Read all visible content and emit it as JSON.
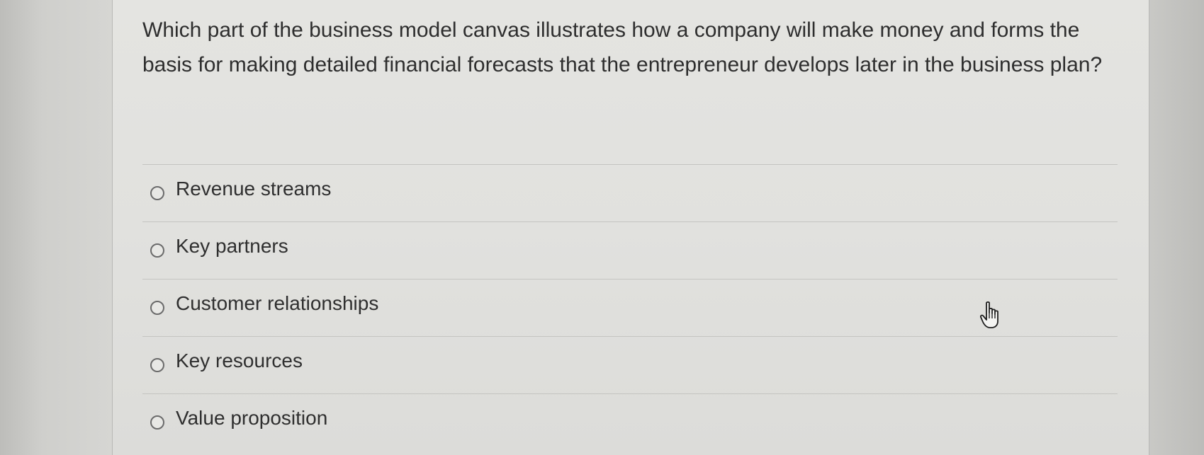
{
  "question": {
    "text": "Which part of the business model canvas illustrates how a company will make money and forms the basis for making detailed financial forecasts that the entrepreneur develops later in the business plan?"
  },
  "options": [
    {
      "label": "Revenue streams",
      "selected": false
    },
    {
      "label": "Key partners",
      "selected": false
    },
    {
      "label": "Customer relationships",
      "selected": false
    },
    {
      "label": "Key resources",
      "selected": false
    },
    {
      "label": "Value proposition",
      "selected": false
    }
  ],
  "cursor": {
    "icon": "hand-pointer-icon"
  }
}
